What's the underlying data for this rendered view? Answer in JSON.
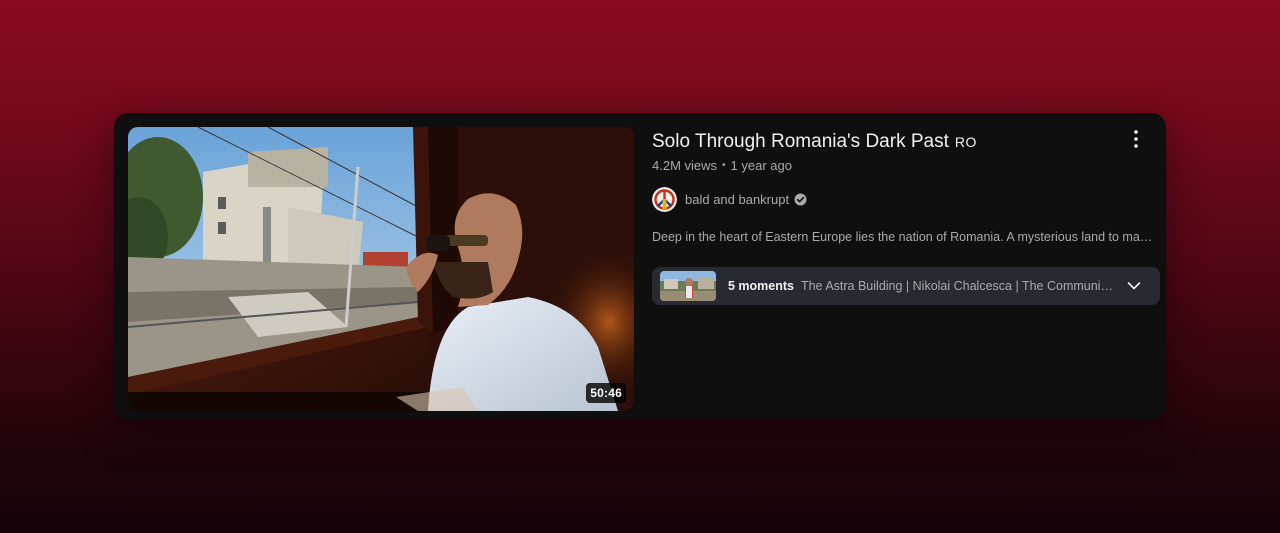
{
  "video": {
    "title": "Solo Through Romania's Dark Past",
    "country_code": "RO",
    "views": "4.2M views",
    "separator": "•",
    "age": "1 year ago",
    "duration": "50:46",
    "description": "Deep in the heart of Eastern Europe lies the nation of Romania. A mysterious land to make you wonder about its history and culture."
  },
  "channel": {
    "name": "bald and bankrupt",
    "verified_icon": "verified-check-icon",
    "avatar_icon": "peace-sign-avatar"
  },
  "moments": {
    "count_label": "5 moments",
    "chapters_text": "The Astra Building | Nikolai Chalcesca | The Communist Era | Train Journey | Bucharest"
  },
  "icons": {
    "menu": "more-vert-icon",
    "expand": "chevron-down-icon"
  },
  "colors": {
    "background_top": "#8a0a20",
    "background_bottom": "#17030a",
    "card": "#0f0f0f",
    "moments_bg": "#272a30",
    "text_primary": "#f1f1f1",
    "text_secondary": "#aaaaaa"
  }
}
